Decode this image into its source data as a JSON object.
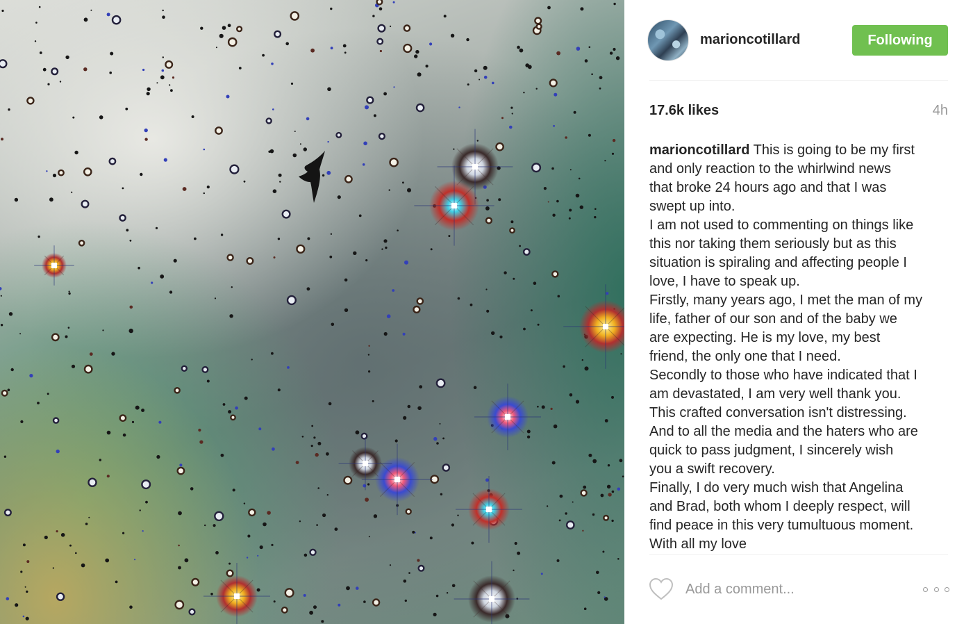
{
  "post": {
    "username": "marioncotillard",
    "follow_label": "Following",
    "likes": "17.6k likes",
    "time": "4h",
    "caption_user": "marioncotillard",
    "caption_first_line": " This is going to be my first",
    "caption_lines": [
      "and only reaction to the whirlwind news",
      "that broke 24 hours ago and that I was",
      "swept up into.",
      "I am not used to commenting on things like",
      "this nor taking them seriously but as this",
      "situation is spiraling and affecting people I",
      "love, I have to speak up.",
      "Firstly, many years ago, I met the man of my",
      "life, father of our son and of the baby we",
      "are expecting. He is my love, my best",
      "friend, the only one that I need.",
      "Secondly to those who have indicated that I",
      "am devastated, I am very well thank you.",
      "This crafted conversation isn't distressing.",
      "And to all the media and the haters who are",
      "quick to pass judgment, I sincerely wish",
      "you a swift recovery.",
      "Finally, I do very much wish that Angelina",
      "and Brad, both whom I deeply respect, will",
      "find peace in this very tumultuous moment.",
      "With all my love"
    ],
    "comment_placeholder": "Add a comment...",
    "icons": {
      "like": "heart-icon",
      "more": "more-options-icon"
    },
    "colors": {
      "follow_button": "#70c050",
      "muted_text": "#999999"
    }
  }
}
